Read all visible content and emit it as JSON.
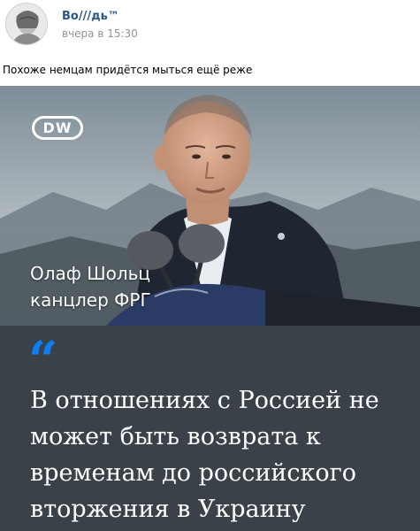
{
  "post": {
    "author": "Во///дь™",
    "time": "вчера в 15:30",
    "text": "Похоже немцам придётся мыться ещё реже"
  },
  "image": {
    "logo_text": "DW",
    "caption_name": "Олаф Шольц",
    "caption_role": "канцлер ФРГ",
    "quote_mark": "“",
    "quote_text": "В отношениях с Россией не может быть возврата к временам до российского вторжения в Украину"
  },
  "colors": {
    "author_link": "#2a5885",
    "timestamp": "#939393",
    "quote_panel": "#3a4148",
    "quote_mark": "#0e7ff1"
  }
}
